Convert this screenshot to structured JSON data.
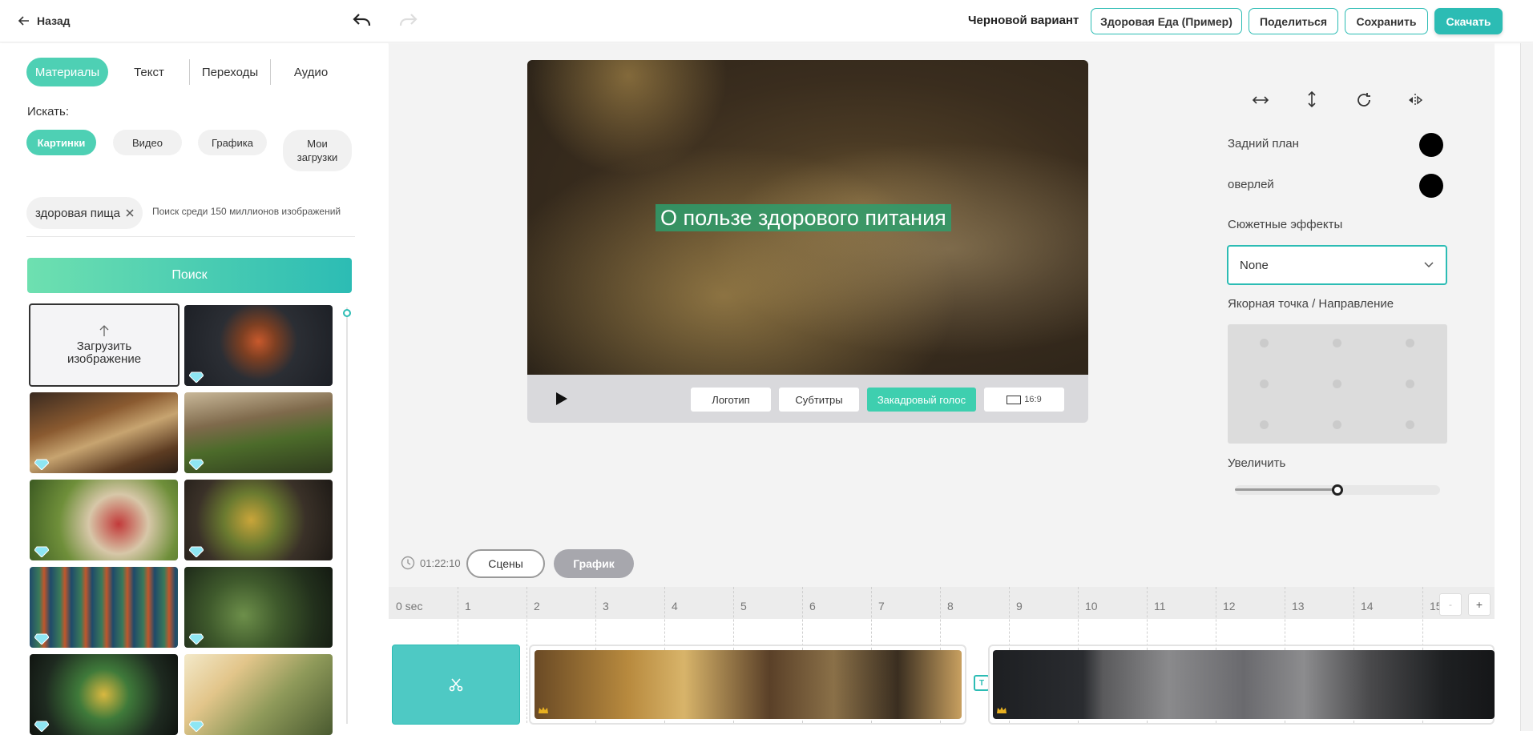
{
  "header": {
    "back_label": "Назад",
    "draft_label": "Черновой вариант",
    "project_button": "Здоровая Еда (Пример)",
    "share_button": "Поделиться",
    "save_button": "Сохранить",
    "download_button": "Скачать"
  },
  "left": {
    "tabs": [
      "Материалы",
      "Текст",
      "Переходы",
      "Аудио"
    ],
    "search_heading": "Искать:",
    "media_types": [
      "Картинки",
      "Видео",
      "Графика",
      "Мои загрузки"
    ],
    "search_query": "здоровая пища",
    "search_hint": "Поиск среди 150 миллионов изображений",
    "search_button": "Поиск",
    "upload_label": "Загрузить изображение"
  },
  "preview": {
    "caption": "О пользе здорового питания",
    "buttons": [
      "Логотип",
      "Субтитры",
      "Закадровый голос"
    ],
    "aspect_label": "16:9"
  },
  "props": {
    "background_label": "Задний план",
    "overlay_label": "оверлей",
    "effects_label": "Сюжетные эффекты",
    "effects_value": "None",
    "anchor_label": "Якорная точка / Направление",
    "zoom_label": "Увеличить",
    "zoom_value": 0.5,
    "colors": {
      "background": "#000000",
      "overlay": "#000000",
      "accent": "#2cbcb4"
    }
  },
  "timeline": {
    "duration": "01:22:10",
    "mode_scenes": "Сцены",
    "mode_graph": "График",
    "ticks": [
      "0 sec",
      "1",
      "2",
      "3",
      "4",
      "5",
      "6",
      "7",
      "8",
      "9",
      "10",
      "11",
      "12",
      "13",
      "14",
      "15"
    ],
    "zoom_minus": "-",
    "zoom_plus": "+",
    "text_marker": "T"
  }
}
